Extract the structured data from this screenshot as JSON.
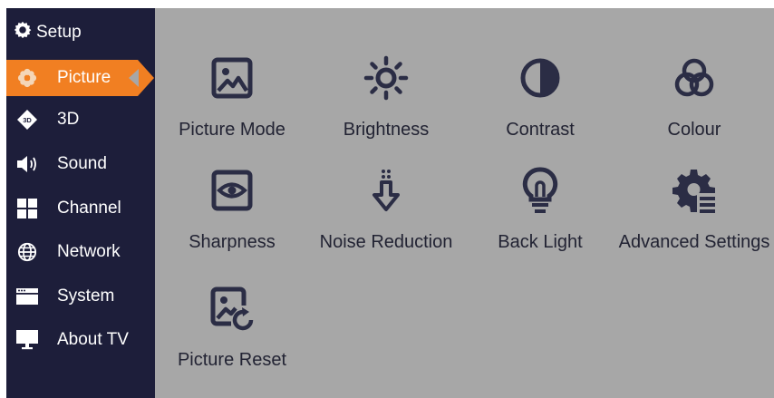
{
  "setup": {
    "label": "Setup",
    "icon": "gear-icon"
  },
  "sidebar": {
    "items": [
      {
        "label": "Picture",
        "icon": "flower-icon",
        "active": true
      },
      {
        "label": "3D",
        "icon": "3d-icon"
      },
      {
        "label": "Sound",
        "icon": "speaker-icon"
      },
      {
        "label": "Channel",
        "icon": "grid-icon"
      },
      {
        "label": "Network",
        "icon": "globe-icon"
      },
      {
        "label": "System",
        "icon": "system-window-icon"
      },
      {
        "label": "About TV",
        "icon": "monitor-icon"
      }
    ]
  },
  "main": {
    "tiles": [
      {
        "label": "Picture Mode",
        "icon": "image-icon"
      },
      {
        "label": "Brightness",
        "icon": "sun-icon"
      },
      {
        "label": "Contrast",
        "icon": "contrast-icon"
      },
      {
        "label": "Colour",
        "icon": "color-circles-icon"
      },
      {
        "label": "Sharpness",
        "icon": "eye-icon"
      },
      {
        "label": "Noise Reduction",
        "icon": "noise-arrow-icon"
      },
      {
        "label": "Back Light",
        "icon": "bulb-icon"
      },
      {
        "label": "Advanced Settings",
        "icon": "gear-list-icon"
      },
      {
        "label": "Picture Reset",
        "icon": "image-reset-icon"
      }
    ]
  },
  "colors": {
    "sidebar_bg": "#1d1e3a",
    "main_bg": "#a7a7a7",
    "accent": "#f17f22",
    "icon": "#2b2d45"
  }
}
